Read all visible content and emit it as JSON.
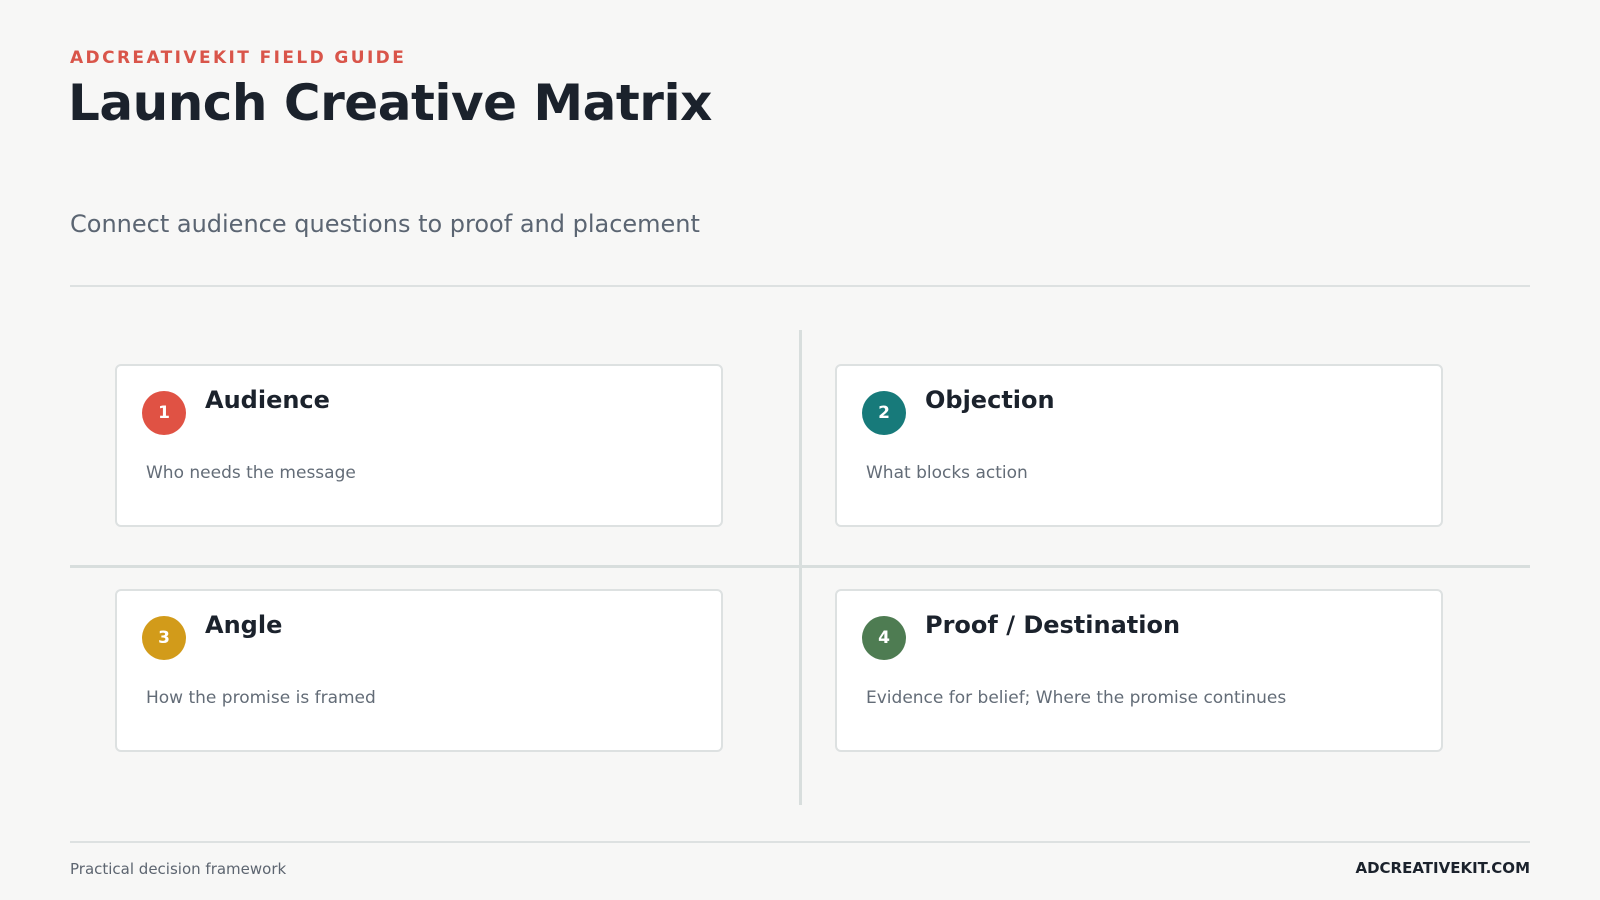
{
  "header": {
    "eyebrow": "ADCREATIVEKIT FIELD GUIDE",
    "title": "Launch Creative Matrix",
    "subtitle": "Connect audience questions to proof and placement"
  },
  "matrix": {
    "cells": [
      {
        "number": "1",
        "title": "Audience",
        "description": "Who needs the message",
        "color": "#e05244"
      },
      {
        "number": "2",
        "title": "Objection",
        "description": "What blocks action",
        "color": "#177a7a"
      },
      {
        "number": "3",
        "title": "Angle",
        "description": "How the promise is framed",
        "color": "#d29b1a"
      },
      {
        "number": "4",
        "title": "Proof / Destination",
        "description": "Evidence for belief; Where the promise continues",
        "color": "#4e7c52"
      }
    ]
  },
  "footer": {
    "left": "Practical decision framework",
    "right": "ADCREATIVEKIT.COM"
  },
  "colors": {
    "accent": "#d9554a",
    "background": "#f7f7f6",
    "rule": "#dde1e1"
  }
}
